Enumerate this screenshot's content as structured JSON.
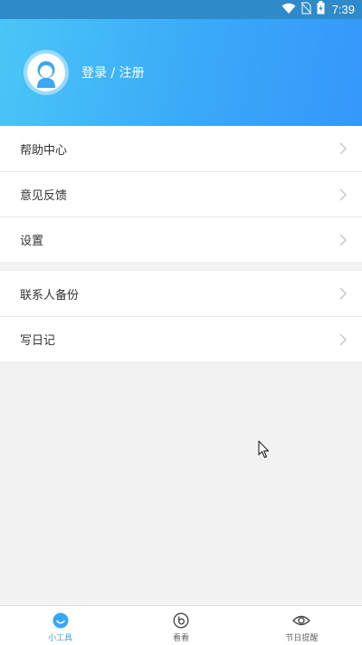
{
  "status_bar": {
    "time": "7:39",
    "icons": [
      "wifi-icon",
      "no-sim-icon",
      "battery-charging-icon"
    ]
  },
  "profile": {
    "login_label": "登录 / 注册",
    "avatar_icon": "user-avatar-icon"
  },
  "menu_section_1": [
    {
      "label": "帮助中心"
    },
    {
      "label": "意见反馈"
    },
    {
      "label": "设置"
    }
  ],
  "menu_section_2": [
    {
      "label": "联系人备份"
    },
    {
      "label": "写日记"
    }
  ],
  "tabbar": {
    "tabs": [
      {
        "label": "小工具",
        "icon": "smile-icon",
        "active": true
      },
      {
        "label": "看看",
        "icon": "play-circle-icon",
        "active": false
      },
      {
        "label": "节日提醒",
        "icon": "eye-icon",
        "active": false
      }
    ]
  },
  "colors": {
    "header_start": "#4bc6f7",
    "header_end": "#3597fb",
    "accent": "#3aa6f5"
  }
}
